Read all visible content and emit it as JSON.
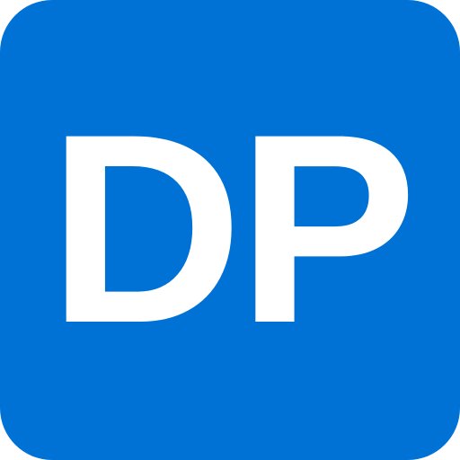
{
  "icon": {
    "monogram": "DP",
    "background_color": "#0072d6",
    "text_color": "#ffffff"
  }
}
